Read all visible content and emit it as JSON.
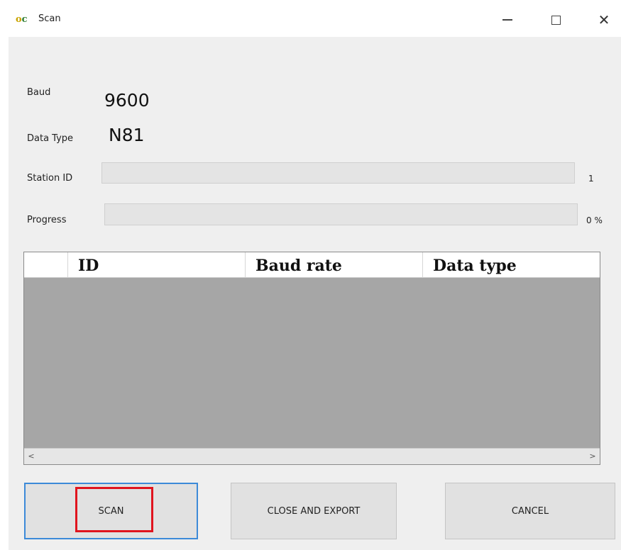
{
  "window": {
    "title": "Scan",
    "icon_text_o": "o",
    "icon_text_c": "c",
    "controls": {
      "minimize": "minimize-icon",
      "maximize": "maximize-icon",
      "close": "close-icon",
      "close_glyph": "✕"
    }
  },
  "fields": {
    "baud_label": "Baud",
    "baud_value": "9600",
    "data_type_label": "Data Type",
    "data_type_value": "N81",
    "station_id_label": "Station ID",
    "station_id_value": "1",
    "progress_label": "Progress",
    "progress_value": "0 %"
  },
  "progress": {
    "station_fraction": 0.0,
    "progress_fraction": 0.0
  },
  "table": {
    "columns": [
      "",
      "ID",
      "Baud rate",
      "Data type"
    ],
    "rows": [],
    "scroll_left": "<",
    "scroll_right": ">"
  },
  "buttons": {
    "scan": "SCAN",
    "close_export": "CLOSE AND EXPORT",
    "cancel": "CANCEL"
  },
  "colors": {
    "highlight": "#e0141e",
    "focus_border": "#3c8ad8",
    "table_body": "#a6a6a6"
  }
}
